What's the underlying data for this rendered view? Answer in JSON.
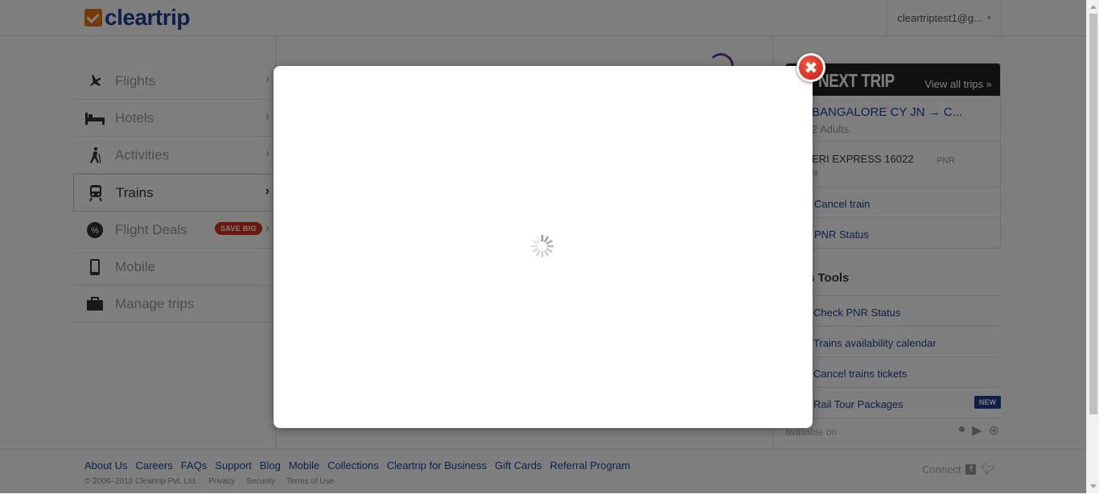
{
  "header": {
    "logo_text": "cleartrip",
    "user_menu_label": "cleartriptest1@g...",
    "user_menu_caret": "▾"
  },
  "sidebar": {
    "items": [
      {
        "label": "Flights",
        "icon": "plane-icon"
      },
      {
        "label": "Hotels",
        "icon": "bed-icon"
      },
      {
        "label": "Activities",
        "icon": "hiker-icon"
      },
      {
        "label": "Trains",
        "icon": "train-icon",
        "active": true
      },
      {
        "label": "Flight Deals",
        "icon": "percent-badge-icon",
        "badge": "SAVE BIG"
      },
      {
        "label": "Mobile",
        "icon": "mobile-icon"
      },
      {
        "label": "Manage trips",
        "icon": "briefcase-icon"
      }
    ]
  },
  "next_trip": {
    "title": "NEXT TRIP",
    "view_all": "View all trips »",
    "route": "BANGALORE CY JN → C...",
    "travellers": "2 Adults",
    "train": "ERI EXPRESS 16022",
    "train_sub": "N",
    "pnr_label": "PNR",
    "links": [
      "Cancel train",
      "PNR Status"
    ]
  },
  "tools": {
    "title": "s Tools",
    "links": [
      "Check PNR Status",
      "Trains availability calendar",
      "Cancel trains tickets",
      "Rail Tour Packages"
    ],
    "new_badge": "NEW",
    "available_on": "available on"
  },
  "footer": {
    "links": [
      "About Us",
      "Careers",
      "FAQs",
      "Support",
      "Blog",
      "Mobile",
      "Collections",
      "Cleartrip for Business",
      "Gift Cards",
      "Referral Program"
    ],
    "copyright": "© 2006–2018 Cleartrip Pvt. Ltd.",
    "legal": [
      "Privacy",
      "Security",
      "Terms of Use"
    ],
    "connect_label": "Connect"
  },
  "modal": {
    "close_symbol": "✖"
  },
  "colors": {
    "brand_blue": "#1c3f94",
    "brand_orange": "#e87511",
    "badge_red": "#d6321c",
    "overlay": "rgba(0,0,0,0.5)"
  }
}
